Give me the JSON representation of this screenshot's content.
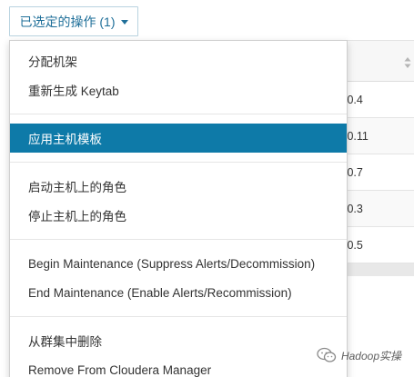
{
  "toggle": {
    "label": "已选定的操作 (1)",
    "icon": "caret-down-icon"
  },
  "menu": {
    "groups": [
      {
        "items": [
          "分配机架",
          "重新生成 Keytab"
        ]
      },
      {
        "items": [
          "应用主机模板"
        ],
        "active_index": 0
      },
      {
        "items": [
          "启动主机上的角色",
          "停止主机上的角色"
        ]
      },
      {
        "items": [
          "Begin Maintenance (Suppress Alerts/Decommission)",
          "End Maintenance (Enable Alerts/Recommission)"
        ]
      },
      {
        "items": [
          "从群集中删除",
          "Remove From Cloudera Manager"
        ]
      }
    ]
  },
  "table": {
    "sort_icon": "sort-icon",
    "rows": [
      ".0.4",
      ".0.11",
      ".0.7",
      ".0.3",
      ".0.5"
    ]
  },
  "watermark": {
    "text": "Hadoop实操",
    "icon": "wechat-icon"
  },
  "colors": {
    "accent": "#0e7aa8",
    "toggle_text": "#1f6f99"
  }
}
